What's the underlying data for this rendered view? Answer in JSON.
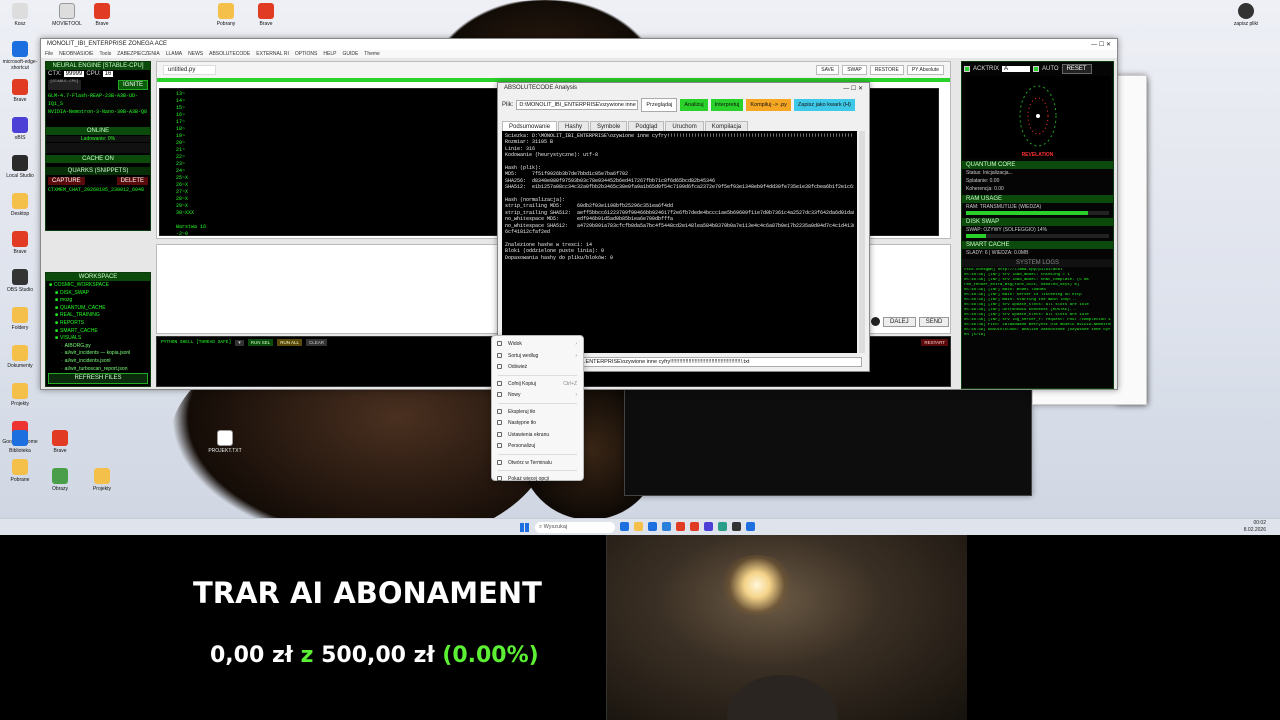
{
  "desktop": {
    "icons_left": [
      "Kosz",
      "microsoft-edge-shortcut",
      "Brave",
      "oBIS",
      "Local Studio",
      "Desktop",
      "Brave",
      "OBS Studio",
      "Foldery",
      "Dokumenty",
      "Projekty",
      "Google Chrome",
      "Pobrane",
      "Biblioteka",
      "Brave",
      "Obrazy",
      "Projekty"
    ],
    "icon_top_items": [
      "MOVIETOOL",
      "Brave",
      "Pobrany",
      "Brave"
    ],
    "icon_right": "zapisz pliki",
    "file_icon": "PROJEKT.TXT"
  },
  "main_window": {
    "title": "MONOLIT_IBI_ENTERPRISE ZONEGA ACE",
    "menu": [
      "File",
      "NEOBNASIOIE",
      "Tools",
      "ZABEZPIECZENIA",
      "LLAMA",
      "NEWS",
      "ABSOLUTECODE",
      "EXTERNAL RI",
      "OPTIONS",
      "HELP",
      "GUIDE",
      "Theme"
    ],
    "left": {
      "engine_header": "NEURAL ENGINE [STABLE-CPU]",
      "ctx_label": "CTX:",
      "ctx_value": "99999",
      "cpu_label": "CPU:",
      "cpu_value": "16",
      "small_tag": "[STABLE-CPU]",
      "ignite": "IGNITE",
      "models": [
        "GLM-4.7-Flash-REAP-23B-A3B-UD-IQ1_S",
        "NVIDIA-Nemotron-3-Nano-30B-A3B-Q8"
      ],
      "online": "ONLINE",
      "loading": "Ladowanie: 0%",
      "cache_on": "CACHE ON",
      "quarks_header": "QUARKS (SNIPPETS)",
      "capture": "CAPTURE",
      "delete": "DELETE",
      "snippet": "CTXMEM_CHAT_20260105_230012_6048",
      "workspace_header": "WORKSPACE",
      "tree": [
        "COSMIC_WORKSPACE",
        "DISK_SWAP",
        "mozg",
        "QUANTUM_CACHE",
        "REAL_TRAINING",
        "REPORTS",
        "SMART_CACHE",
        "VISUALS",
        "AIBORG.py",
        "ai/wir_incidents — kopia.jsonl",
        "ai/wir_incidents.jsonl",
        "ai/wir_turboscan_report.json"
      ],
      "refresh": "REFRESH FILES"
    },
    "editor": {
      "file_tab": "untitled.py",
      "buttons": [
        "SAVE",
        "SWAP",
        "RESTORE",
        "PY Absolute"
      ],
      "line_numbers": [
        "13",
        "14",
        "15",
        "16",
        "17",
        "18",
        "19",
        "20",
        "21",
        "22",
        "23",
        "24",
        "25",
        "26",
        "27",
        "28",
        "29",
        "30"
      ],
      "code": [
        "13~",
        "14~",
        "15~",
        "16~",
        "17~",
        "18~",
        "19~",
        "20~",
        "21~",
        "22~",
        "23~",
        "24~",
        "25~X",
        "26~X",
        "27~X",
        "28~X",
        "29~X",
        "30~XXX",
        "",
        "Warstwa 16",
        "  -2~0"
      ]
    },
    "chat_buttons": [
      "DALEJ",
      "SEND"
    ],
    "shell": {
      "label": "PYTHON SHELL [THREAD SAFE]",
      "buttons": [
        "RUN SEL",
        "RUN ALL",
        "CLEAR"
      ],
      "restart": "RESTART"
    },
    "right": {
      "acktrix": "ACKTRIX",
      "field_value": "A",
      "auto": "AUTO",
      "reset": "RESET",
      "revelation": "REVELATION",
      "quantum_core": "QUANTUM CORE",
      "status": "Status: Inicjalizacja...",
      "splatanie": "Splatanie: 0.00",
      "koherencja": "Koherencja: 0.00",
      "ram_usage": "RAM USAGE",
      "ram_text": "RAM: TRANSMUTUJE (WIEDZA)",
      "ram_fill": 0.85,
      "disk_swap": "DISK SWAP",
      "swap_text": "SWAP: OZYWY (SOLFEGGIO) 14%",
      "swap_fill": 0.14,
      "smart_cache": "SMART CACHE",
      "smart_text": "SLADY: 6 | WIEDZA: 0.0MB",
      "logs_header": "SYSTEM LOGS",
      "logs": [
        "tsck.consg@R] http://llama.cpp/pilui/acbl",
        "05:48:36] [INF] srv  load_model: thinking = 1",
        "05:48:36] [INF] srv  load_model: chat_template: (5 ms",
        "ran_render_extra_msg(func_dict, handled_keys) %]",
        "05:48:36] [INF] main: model loaded",
        "05:48:36] [INF] main: server is listening on http",
        "05:48:36] [INF] main: starting the main loop...",
        "05:48:36] [INF] srv  update_slots: all slots are idle",
        "05:48:36] [INF] ustronowiu kontekst [KOSTKE]...",
        "05:48:36] [INF] srv  update_slots: all slots are idle",
        "05:48:36] [INF] srv  log_server_r: request: POST /completion 127.0.0.1 200",
        "05:48:36] PIER: Zaladowane metrykst dla modelu NVIDIA-Nemotron-3-Nano-30B-A3B-Q8",
        "05:48:36] ABSOLUTECODE: analize zakonczone (ozywione inne cyfry)",
        "ed  [5/16]"
      ]
    }
  },
  "analyzer": {
    "title": "ABSOLUTECODE Analysis",
    "plik_label": "Plik:",
    "plik_value": "D:\\MONOLIT_IBI_ENTERPRISE\\ozywione inne cyfr",
    "buttons": [
      "Przeglądaj",
      "Analizuj",
      "Interpretuj",
      "Kompiluj -> .py",
      "Zapisz jako kwark (H)"
    ],
    "tabs": [
      "Podsumowanie",
      "Hashy",
      "Symbole",
      "Podgląd",
      "Uruchom",
      "Kompilacja"
    ],
    "summary": [
      "Sciezka: D:\\MONOLIT_IBI_ENTERPRISE\\ozywione inne cyfry!!!!!!!!!!!!!!!!!!!!!!!!!!!!!!!!!!!!!!!!!!!!!!!!!!!!!!!!!!!!!!!!.txt",
      "Rozmiar: 31105 B",
      "Linie: 316",
      "Kodowanie (heurystyczne): utf-8",
      "",
      "Hash (plik):",
      "MD5:     7f51f9926b3b7de7bbd1c05e7ba6f702",
      "SHA256:  d8340e080f97593b03c78e934452b6ed417267fbb71c8f6d65bcd82b45346",
      "SHA512:  e1b1257a08cc34c32a0fbb2b3465c38e0fa9a1b65d0f54c7109d6fca2372e79f5ef93e1348eb9f4dd30fe735e1e38fcbea6b1f2e1c617d37c583f2d0df81df0f9",
      "",
      "Hash (normalizacja):",
      "strip_trailing MD5:     60db2f03e1198bfb25296c351ea6f4dd",
      "strip_trailing SHA512:  aeff5bbcc61223709f90466bb924617f2e6fb7dede4bccc1ae5b69609f11e7d0b7361c4a2527dc33f642da6d01da8a2aea742a6ccfccd39025937bf3d45cf701",
      "no_whitespace MD5:      edf946b91d5ad0b85b1ea6e700dbfffa",
      "no_whitespace SHA512:   a4729b891a783cfcfb8da5a7bc4f5448cd2e148lea584b8370b0a7e113e4c4c6a87b0e17b2235a0d04d7c4c1d4138ef4cf326807fca29998",
      "6cf41812cfaf2ed",
      "",
      "Znalezione hashe w tresci: 14",
      "Bloki (oddzielone puste linia): 0",
      "Dopasowania hashy do pliku/bloków: 0"
    ],
    "path_bar": ".ENTERPRISE\\ozywione inne cyfry!!!!!!!!!!!!!!!!!!!!!!!!!!!!!!!!!!!!!!!!!!!!!!!.txt"
  },
  "context_menu": {
    "items": [
      {
        "label": "Widok",
        "arrow": "›",
        "dim": false
      },
      {
        "label": "Sortuj według",
        "arrow": "›",
        "dim": false
      },
      {
        "label": "Odśwież",
        "arrow": "",
        "dim": false
      },
      {
        "sep": true
      },
      {
        "label": "Cofnij Kopiuj",
        "arrow": "Ctrl+Z",
        "dim": false
      },
      {
        "label": "Nowy",
        "arrow": "›",
        "dim": false
      },
      {
        "sep": true
      },
      {
        "label": "Ekspleruj tło",
        "arrow": "",
        "dim": false
      },
      {
        "label": "Następne tło",
        "arrow": "",
        "dim": false
      },
      {
        "label": "Ustawienia ekranu",
        "arrow": "",
        "dim": false
      },
      {
        "label": "Personalizuj",
        "arrow": "",
        "dim": false
      },
      {
        "sep": true
      },
      {
        "label": "Otwórz w Terminalu",
        "arrow": "",
        "dim": false
      },
      {
        "sep": true
      },
      {
        "label": "Pokaż więcej opcji",
        "arrow": "",
        "dim": false
      }
    ]
  },
  "taskbar": {
    "search": "Wyszukaj",
    "time": "00:02",
    "date": "8.02.2026"
  },
  "overlay": {
    "title": "TRAR AI ABONAMENT",
    "amount_current": "0,00 zł",
    "connector": "z",
    "amount_goal": "500,00 zł",
    "percent": "(0.00%)",
    "progress": 0.0
  },
  "colors": {
    "terminal_green": "#22ff22",
    "panel_dark_green": "#0b4a0b",
    "accent_green": "#5cf035",
    "btn_green": "#2ad12a",
    "btn_orange": "#f5a623",
    "btn_cyan": "#3ec9e8",
    "red_text": "#ff3030"
  }
}
